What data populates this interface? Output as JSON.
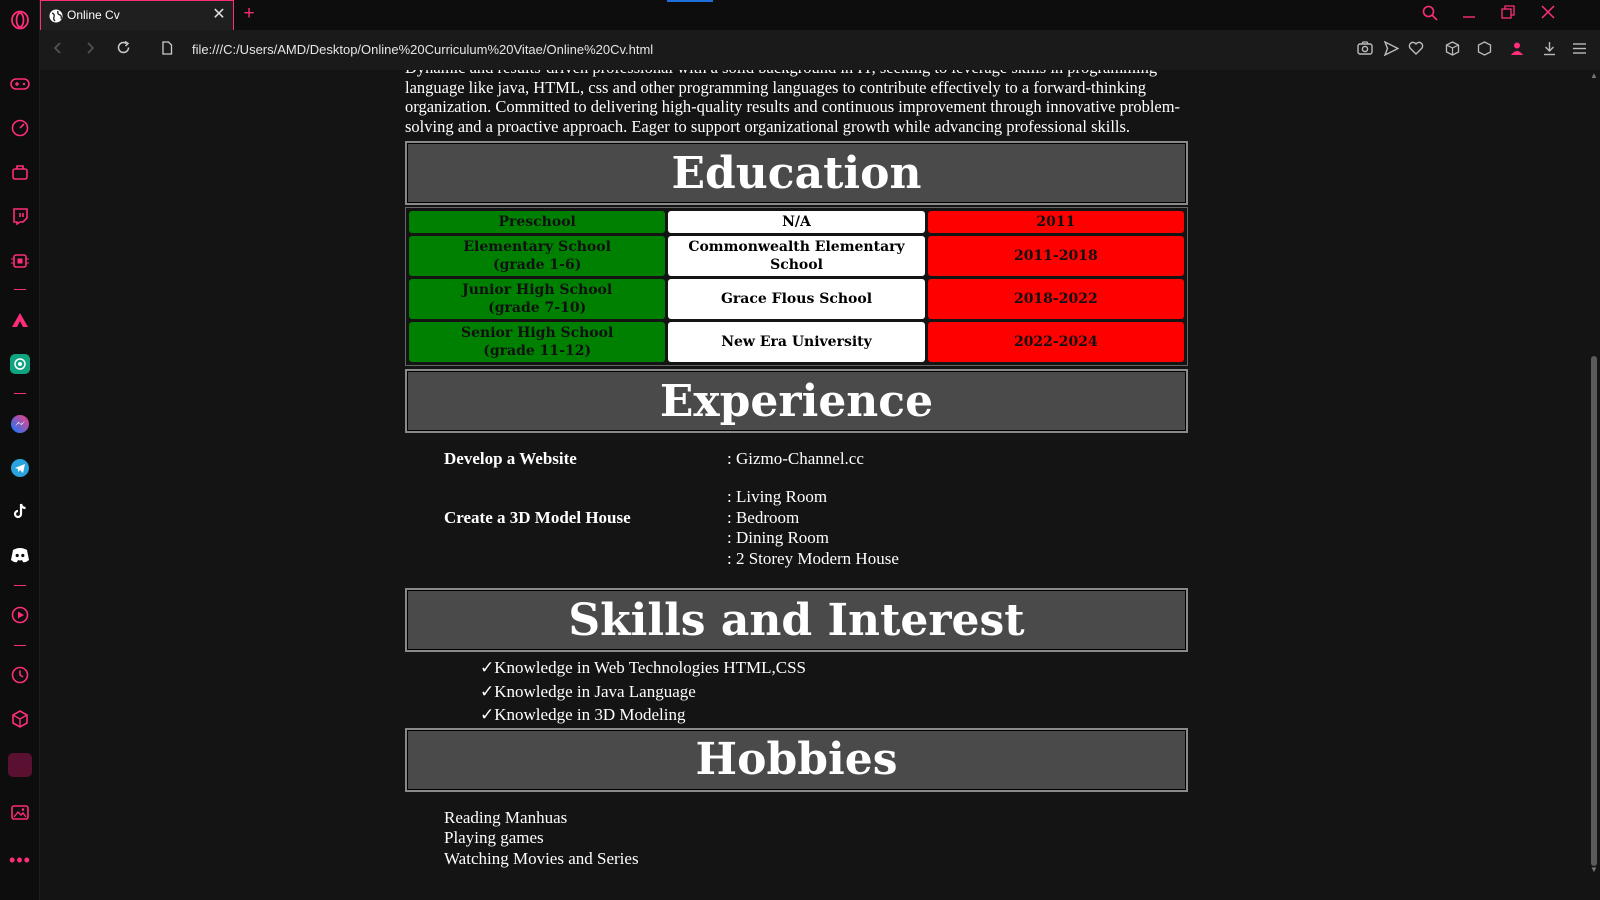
{
  "browser": {
    "tab_title": "Online Cv",
    "tab_close": "✕",
    "new_tab": "+",
    "url": "file:///C:/Users/AMD/Desktop/Online%20Curriculum%20Vitae/Online%20Cv.html",
    "accent_color": "#ff2d7a"
  },
  "cv": {
    "intro": "Dynamic and results-driven professional with a solid background in IT, seeking to leverage skills in programming language like java, HTML, css and other programming languages to contribute effectively to a forward-thinking organization. Committed to delivering high-quality results and continuous improvement through innovative problem-solving and a proactive approach. Eager to support organizational growth while advancing professional skills.",
    "education": {
      "heading": "Education",
      "rows": [
        {
          "level": "Preschool",
          "school": "N/A",
          "years": "2011"
        },
        {
          "level": "Elementary School",
          "grade": "(grade 1-6)",
          "school": "Commonwealth Elementary School",
          "years": "2011-2018"
        },
        {
          "level": "Junior High School",
          "grade": "(grade 7-10)",
          "school": "Grace Flous School",
          "years": "2018-2022"
        },
        {
          "level": "Senior High School",
          "grade": "(grade 11-12)",
          "school": "New Era University",
          "years": "2022-2024"
        }
      ],
      "colors": {
        "level": "#008000",
        "school": "#ffffff",
        "years": "#ff0000"
      }
    },
    "experience": {
      "heading": "Experience",
      "items": [
        {
          "title": "Develop a Website",
          "values": [
            ": Gizmo-Channel.cc"
          ]
        },
        {
          "title": "Create a 3D Model House",
          "values": [
            ": Living Room",
            ": Bedroom",
            ": Dining Room",
            ": 2 Storey Modern House"
          ]
        }
      ]
    },
    "skills": {
      "heading": "Skills and Interest",
      "items": [
        "✓Knowledge in Web Technologies HTML,CSS",
        "✓Knowledge in Java Language",
        "✓Knowledge in 3D Modeling"
      ]
    },
    "hobbies": {
      "heading": "Hobbies",
      "items": [
        "Reading Manhuas",
        "Playing games",
        "Watching Movies and Series"
      ]
    }
  },
  "icons": {
    "sidebar": [
      "opera-logo-icon",
      "gamepad-icon",
      "speed-dial-icon",
      "bag-icon",
      "twitch-icon",
      "cpu-icon",
      "aria-icon",
      "chatgpt-icon",
      "messenger-icon",
      "telegram-icon",
      "tiktok-icon",
      "discord-icon",
      "player-icon",
      "history-icon",
      "cube-icon",
      "workspace-icon",
      "gallery-icon",
      "more-icon"
    ],
    "toolbar": [
      "camera-icon",
      "send-icon",
      "heart-icon",
      "box-icon",
      "vpn-box-icon",
      "profile-icon",
      "download-icon",
      "menu-icon"
    ]
  }
}
